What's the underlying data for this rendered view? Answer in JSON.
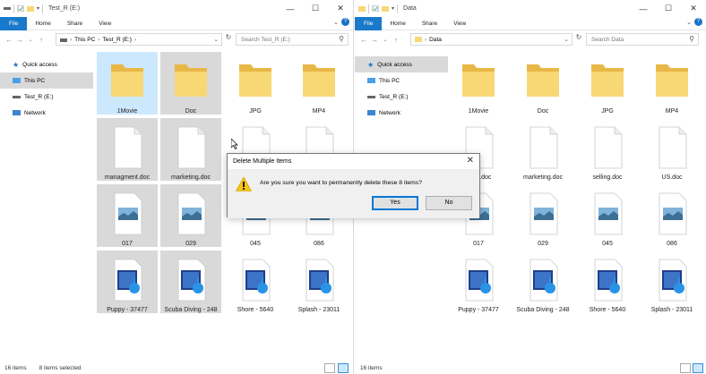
{
  "left": {
    "title": "Test_R (E:)",
    "ribbon_tabs": [
      "File",
      "Home",
      "Share",
      "View"
    ],
    "address": [
      "This PC",
      "Test_R (E:)"
    ],
    "search_placeholder": "Search Test_R (E:)",
    "nav_items": [
      {
        "label": "Quick access",
        "icon": "star-icon"
      },
      {
        "label": "This PC",
        "icon": "pc-icon"
      },
      {
        "label": "Test_R (E:)",
        "icon": "drive-icon"
      },
      {
        "label": "Network",
        "icon": "network-icon"
      }
    ],
    "files": [
      {
        "name": "1Movie",
        "type": "folder",
        "state": "selected"
      },
      {
        "name": "Doc",
        "type": "folder",
        "state": "highlight"
      },
      {
        "name": "JPG",
        "type": "folder",
        "state": ""
      },
      {
        "name": "MP4",
        "type": "folder",
        "state": ""
      },
      {
        "name": "managment.doc",
        "type": "doc",
        "state": "highlight"
      },
      {
        "name": "marketing.doc",
        "type": "doc",
        "state": "highlight"
      },
      {
        "name": "",
        "type": "doc",
        "state": ""
      },
      {
        "name": "",
        "type": "doc",
        "state": ""
      },
      {
        "name": "017",
        "type": "image",
        "state": "highlight"
      },
      {
        "name": "029",
        "type": "image",
        "state": "highlight"
      },
      {
        "name": "045",
        "type": "image",
        "state": ""
      },
      {
        "name": "086",
        "type": "image",
        "state": ""
      },
      {
        "name": "Puppy - 37477",
        "type": "video",
        "state": "highlight"
      },
      {
        "name": "Scuba Diving - 248",
        "type": "video",
        "state": "highlight"
      },
      {
        "name": "Shore - 5640",
        "type": "video",
        "state": ""
      },
      {
        "name": "Splash - 23011",
        "type": "video",
        "state": ""
      }
    ],
    "status_count": "16 items",
    "status_selected": "8 items selected"
  },
  "right": {
    "title": "Data",
    "ribbon_tabs": [
      "File",
      "Home",
      "Share",
      "View"
    ],
    "address": [
      "Data"
    ],
    "search_placeholder": "Search Data",
    "nav_items": [
      {
        "label": "Quick access",
        "icon": "star-icon"
      },
      {
        "label": "This PC",
        "icon": "pc-icon"
      },
      {
        "label": "Test_R (E:)",
        "icon": "drive-icon"
      },
      {
        "label": "Network",
        "icon": "network-icon"
      }
    ],
    "files": [
      {
        "name": "1Movie",
        "type": "folder",
        "state": ""
      },
      {
        "name": "Doc",
        "type": "folder",
        "state": ""
      },
      {
        "name": "JPG",
        "type": "folder",
        "state": ""
      },
      {
        "name": "MP4",
        "type": "folder",
        "state": ""
      },
      {
        "name": "ment.doc",
        "type": "doc",
        "state": ""
      },
      {
        "name": "marketing.doc",
        "type": "doc",
        "state": ""
      },
      {
        "name": "selling.doc",
        "type": "doc",
        "state": ""
      },
      {
        "name": "US.doc",
        "type": "doc",
        "state": ""
      },
      {
        "name": "017",
        "type": "image",
        "state": ""
      },
      {
        "name": "029",
        "type": "image",
        "state": ""
      },
      {
        "name": "045",
        "type": "image",
        "state": ""
      },
      {
        "name": "086",
        "type": "image",
        "state": ""
      },
      {
        "name": "Puppy - 37477",
        "type": "video",
        "state": ""
      },
      {
        "name": "Scuba Diving - 248",
        "type": "video",
        "state": ""
      },
      {
        "name": "Shore - 5640",
        "type": "video",
        "state": ""
      },
      {
        "name": "Splash - 23011",
        "type": "video",
        "state": ""
      }
    ],
    "status_count": "16 items"
  },
  "dialog": {
    "title": "Delete Multiple Items",
    "message": "Are you sure you want to permanently delete these 8 items?",
    "yes_label": "Yes",
    "no_label": "No",
    "close_glyph": "✕"
  },
  "window_buttons": {
    "minimize": "—",
    "maximize": "☐",
    "close": "✕"
  },
  "colors": {
    "accent": "#1979ca",
    "selected": "#cce8ff",
    "highlight": "#d9d9d9",
    "folder": "#f8d775"
  }
}
